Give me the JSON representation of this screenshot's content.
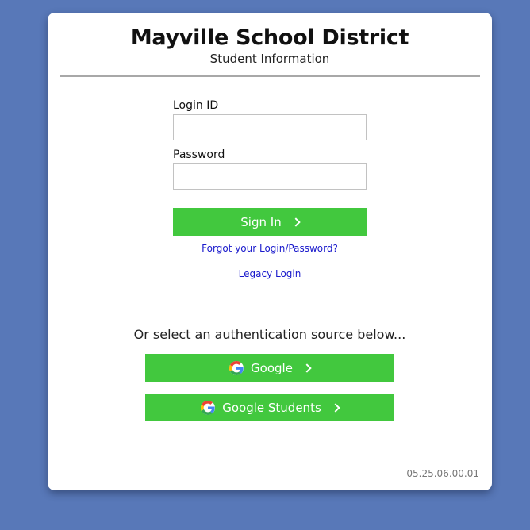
{
  "header": {
    "title": "Mayville School District",
    "subtitle": "Student Information"
  },
  "login": {
    "login_id_label": "Login ID",
    "login_id_value": "",
    "password_label": "Password",
    "password_value": "",
    "sign_in_label": "Sign In",
    "forgot_link": "Forgot your Login/Password?",
    "legacy_link": "Legacy Login"
  },
  "auth": {
    "prompt": "Or select an authentication source below...",
    "sources": [
      {
        "label": "Google",
        "icon": "google-icon"
      },
      {
        "label": "Google Students",
        "icon": "google-icon"
      }
    ]
  },
  "footer": {
    "version": "05.25.06.00.01"
  },
  "colors": {
    "background": "#5878b8",
    "button": "#42c83e",
    "link": "#1a1acc"
  }
}
